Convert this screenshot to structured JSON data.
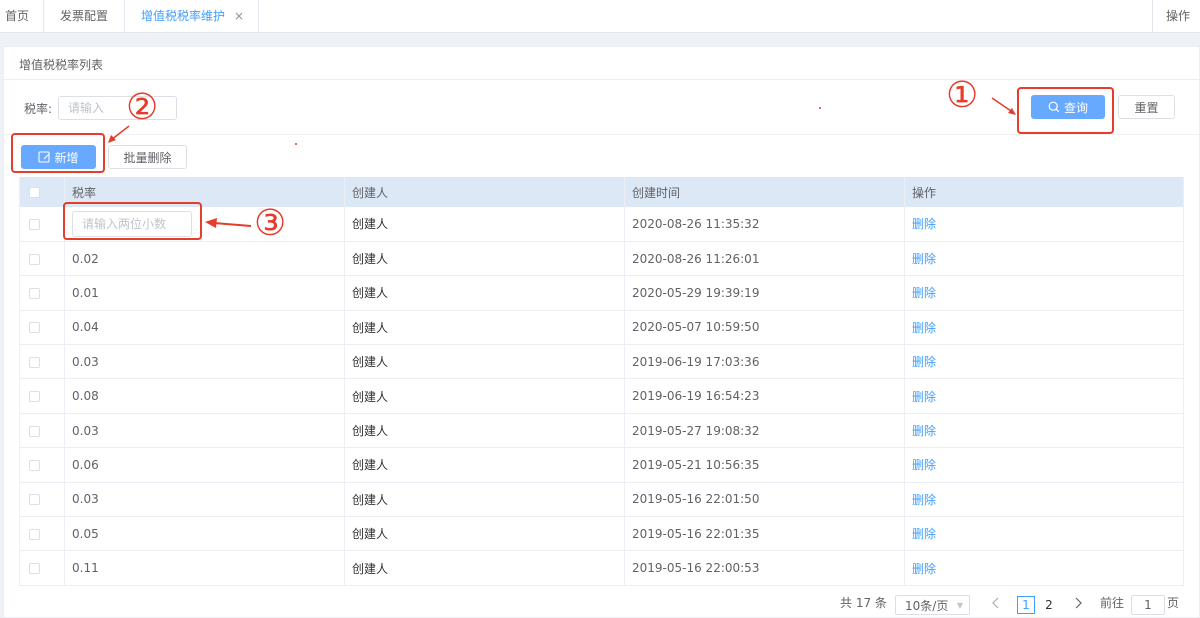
{
  "tabs": [
    {
      "label": "首页"
    },
    {
      "label": "发票配置"
    },
    {
      "label": "增值税税率维护",
      "close": "×"
    }
  ],
  "tabs_ops": "操作",
  "card_title": "增值税税率列表",
  "filter": {
    "label": "税率:",
    "placeholder": "请输入"
  },
  "buttons": {
    "query": "查询",
    "reset": "重置",
    "add": "新增",
    "batch_delete": "批量删除"
  },
  "table": {
    "headers": [
      "税率",
      "创建人",
      "创建时间",
      "操作"
    ],
    "edit_placeholder": "请输入两位小数",
    "rows": [
      {
        "rate": "",
        "creator": "创建人",
        "time": "2020-08-26 11:35:32",
        "action": "删除"
      },
      {
        "rate": "0.02",
        "creator": "创建人",
        "time": "2020-08-26 11:26:01",
        "action": "删除"
      },
      {
        "rate": "0.01",
        "creator": "创建人",
        "time": "2020-05-29 19:39:19",
        "action": "删除"
      },
      {
        "rate": "0.04",
        "creator": "创建人",
        "time": "2020-05-07 10:59:50",
        "action": "删除"
      },
      {
        "rate": "0.03",
        "creator": "创建人",
        "time": "2019-06-19 17:03:36",
        "action": "删除"
      },
      {
        "rate": "0.08",
        "creator": "创建人",
        "time": "2019-06-19 16:54:23",
        "action": "删除"
      },
      {
        "rate": "0.03",
        "creator": "创建人",
        "time": "2019-05-27 19:08:32",
        "action": "删除"
      },
      {
        "rate": "0.06",
        "creator": "创建人",
        "time": "2019-05-21 10:56:35",
        "action": "删除"
      },
      {
        "rate": "0.03",
        "creator": "创建人",
        "time": "2019-05-16 22:01:50",
        "action": "删除"
      },
      {
        "rate": "0.05",
        "creator": "创建人",
        "time": "2019-05-16 22:01:35",
        "action": "删除"
      },
      {
        "rate": "0.11",
        "creator": "创建人",
        "time": "2019-05-16 22:00:53",
        "action": "删除"
      }
    ]
  },
  "pagination": {
    "total": "共 17 条",
    "page_size": "10条/页",
    "pages": [
      "1",
      "2"
    ],
    "current": "1",
    "goto_prefix": "前往",
    "goto_value": "1",
    "goto_suffix": "页"
  },
  "annotations": [
    "①",
    "②",
    "③"
  ],
  "colors": {
    "primary": "#409eff",
    "primary_button": "#66a9ff",
    "annotation": "#e53c2c",
    "header_bg": "#dde8f6"
  }
}
